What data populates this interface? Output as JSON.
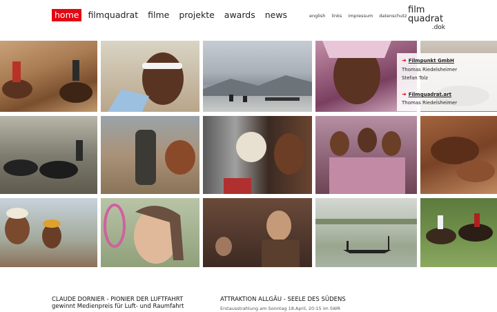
{
  "nav": {
    "items": [
      {
        "label": "home",
        "active": true
      },
      {
        "label": "filmquadrat",
        "active": false
      },
      {
        "label": "filme",
        "active": false
      },
      {
        "label": "projekte",
        "active": false
      },
      {
        "label": "awards",
        "active": false
      },
      {
        "label": "news",
        "active": false
      }
    ],
    "active_color": "#e30613"
  },
  "subnav": {
    "items": [
      "english",
      "links",
      "impressum",
      "datenschutz"
    ]
  },
  "logo": {
    "line1": "film",
    "line2": "quadrat",
    "line3": ".dok"
  },
  "gallery": {
    "count": 15
  },
  "info": {
    "company1": "Filmpunkt GmbH",
    "person1a": "Thomas Riedelsheimer",
    "person1b": "Stefan Tolz",
    "company2": "Filmquadrat.art",
    "person2": "Thomas Riedelsheimer"
  },
  "news": {
    "left_title": "CLAUDE DORNIER - PIONIER DER LUFTFAHRT",
    "left_subtitle": "gewinnt Medienpreis für Luft- und Raumfahrt",
    "right_title": "ATTRAKTION ALLGÄU - SEELE DES SÜDENS",
    "right_subtitle": "Erstausstrahlung am Sonntag 18.April, 20:15 im SWR"
  }
}
